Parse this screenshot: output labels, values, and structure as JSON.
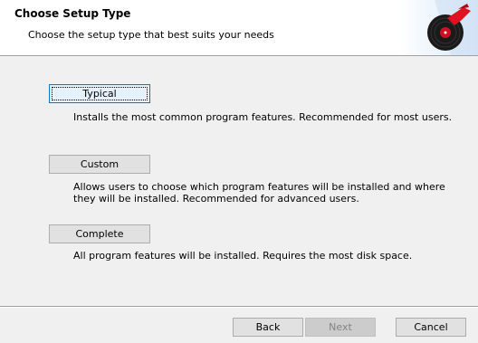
{
  "header": {
    "title": "Choose Setup Type",
    "subtitle": "Choose the setup type that best suits your needs",
    "logo_icon": "vinyl-record-icon"
  },
  "options": [
    {
      "label": "Typical",
      "description": "Installs the most common program features. Recommended for most users."
    },
    {
      "label": "Custom",
      "description_line1": "Allows users to choose which program features will be installed and where",
      "description_line2": "they will be installed. Recommended for advanced users."
    },
    {
      "label": "Complete",
      "description": "All program features will be installed. Requires the most disk space."
    }
  ],
  "footer": {
    "back_label": "Back",
    "next_label": "Next",
    "cancel_label": "Cancel"
  },
  "colors": {
    "focus_border": "#0078d7",
    "logo_red": "#e01020"
  }
}
